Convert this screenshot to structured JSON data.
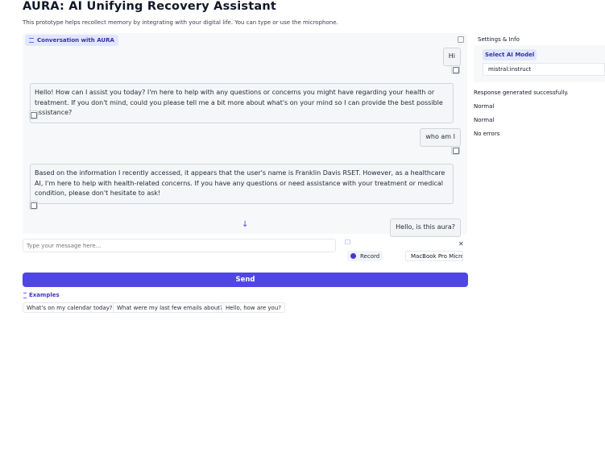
{
  "header": {
    "title": "AURA: AI Unifying Recovery Assistant",
    "subtitle": "This prototype helps recollect memory by integrating with your digital life. You can type or use the microphone."
  },
  "chat": {
    "label": "Conversation with AURA",
    "messages": [
      {
        "role": "user",
        "text": "Hi"
      },
      {
        "role": "assistant",
        "text": "Hello! How can I assist you today? I'm here to help with any questions or concerns you might have regarding your health or treatment. If you don't mind, could you please tell me a bit more about what's on your mind so I can provide the best possible assistance?"
      },
      {
        "role": "user",
        "text": "who am I"
      },
      {
        "role": "assistant",
        "text": "Based on the information I recently accessed, it appears that the user's name is Franklin Davis RSET. However, as a healthcare AI, I'm here to help with health-related concerns. If you have any questions or need assistance with your treatment or medical condition, please don't hesitate to ask!"
      },
      {
        "role": "user",
        "text": "Hello, is this aura?"
      }
    ]
  },
  "input": {
    "placeholder": "Type your message here..."
  },
  "audio": {
    "record_label": "Record",
    "device": "MacBook Pro Microphone"
  },
  "send_label": "Send",
  "examples": {
    "label": "Examples",
    "items": [
      "What's on my calendar today?",
      "What were my last few emails about?",
      "Hello, how are you?"
    ]
  },
  "sidebar": {
    "header": "Settings & Info",
    "model_label": "Select AI Model",
    "model_value": "mistral:instruct",
    "status_lines": [
      "Response generated successfully.",
      "Normal",
      "Normal",
      "No errors"
    ]
  },
  "colors": {
    "accent": "#4f46e5",
    "label_bg": "#e0e7ff"
  }
}
